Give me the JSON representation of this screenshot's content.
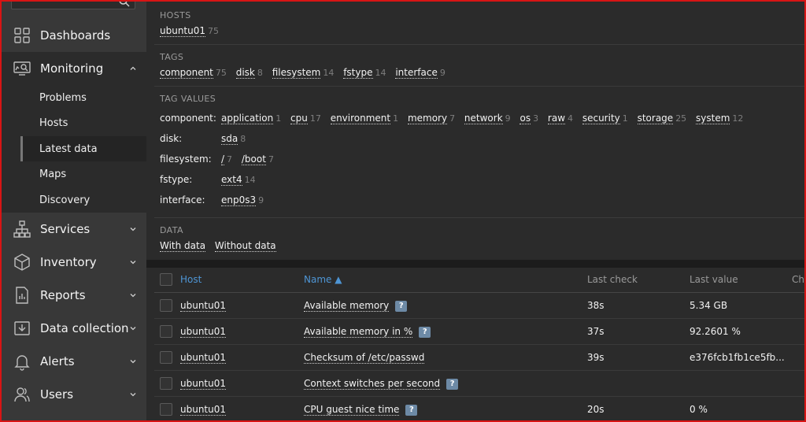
{
  "sidebar": {
    "items": [
      {
        "label": "Dashboards",
        "icon": "dashboards-icon"
      },
      {
        "label": "Monitoring",
        "icon": "monitoring-icon"
      },
      {
        "label": "Services",
        "icon": "services-icon"
      },
      {
        "label": "Inventory",
        "icon": "inventory-icon"
      },
      {
        "label": "Reports",
        "icon": "reports-icon"
      },
      {
        "label": "Data collection",
        "icon": "data-collection-icon"
      },
      {
        "label": "Alerts",
        "icon": "alerts-icon"
      },
      {
        "label": "Users",
        "icon": "users-icon"
      }
    ],
    "monitoring_sub": [
      "Problems",
      "Hosts",
      "Latest data",
      "Maps",
      "Discovery"
    ]
  },
  "filter": {
    "hosts_title": "HOSTS",
    "hosts": [
      {
        "name": "ubuntu01",
        "count": "75"
      }
    ],
    "tags_title": "TAGS",
    "tags": [
      {
        "name": "component",
        "count": "75"
      },
      {
        "name": "disk",
        "count": "8"
      },
      {
        "name": "filesystem",
        "count": "14"
      },
      {
        "name": "fstype",
        "count": "14"
      },
      {
        "name": "interface",
        "count": "9"
      }
    ],
    "tag_values_title": "TAG VALUES",
    "tag_values": [
      {
        "label": "component:",
        "values": [
          {
            "name": "application",
            "count": "1"
          },
          {
            "name": "cpu",
            "count": "17"
          },
          {
            "name": "environment",
            "count": "1"
          },
          {
            "name": "memory",
            "count": "7"
          },
          {
            "name": "network",
            "count": "9"
          },
          {
            "name": "os",
            "count": "3"
          },
          {
            "name": "raw",
            "count": "4"
          },
          {
            "name": "security",
            "count": "1"
          },
          {
            "name": "storage",
            "count": "25"
          },
          {
            "name": "system",
            "count": "12"
          }
        ]
      },
      {
        "label": "disk:",
        "values": [
          {
            "name": "sda",
            "count": "8"
          }
        ]
      },
      {
        "label": "filesystem:",
        "values": [
          {
            "name": "/",
            "count": "7"
          },
          {
            "name": "/boot",
            "count": "7"
          }
        ]
      },
      {
        "label": "fstype:",
        "values": [
          {
            "name": "ext4",
            "count": "14"
          }
        ]
      },
      {
        "label": "interface:",
        "values": [
          {
            "name": "enp0s3",
            "count": "9"
          }
        ]
      }
    ],
    "data_title": "DATA",
    "data_options": [
      "With data",
      "Without data"
    ]
  },
  "table": {
    "headers": {
      "host": "Host",
      "name": "Name ▲",
      "last_check": "Last check",
      "last_value": "Last value",
      "change": "Ch"
    },
    "rows": [
      {
        "host": "ubuntu01",
        "name": "Available memory",
        "help": "?",
        "last_check": "38s",
        "last_value": "5.34 GB"
      },
      {
        "host": "ubuntu01",
        "name": "Available memory in %",
        "help": "?",
        "last_check": "37s",
        "last_value": "92.2601 %"
      },
      {
        "host": "ubuntu01",
        "name": "Checksum of /etc/passwd",
        "help": "",
        "last_check": "39s",
        "last_value": "e376fcb1fb1ce5fb..."
      },
      {
        "host": "ubuntu01",
        "name": "Context switches per second",
        "help": "?",
        "last_check": "",
        "last_value": ""
      },
      {
        "host": "ubuntu01",
        "name": "CPU guest nice time",
        "help": "?",
        "last_check": "20s",
        "last_value": "0 %"
      }
    ]
  },
  "colors": {
    "accent_red": "#d81414",
    "link_blue": "#4e95d4",
    "help_badge": "#6d8aa6"
  }
}
